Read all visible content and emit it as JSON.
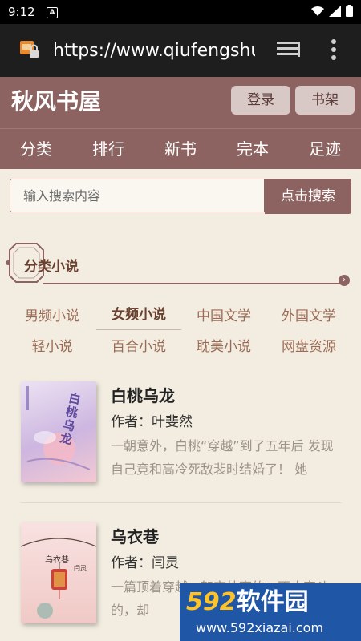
{
  "status_bar": {
    "time": "9:12",
    "notification_letter": "A"
  },
  "browser": {
    "url": "https://www.qiufengshuwu"
  },
  "header": {
    "title": "秋风书屋",
    "login_label": "登录",
    "shelf_label": "书架"
  },
  "nav": {
    "items": [
      "分类",
      "排行",
      "新书",
      "完本",
      "足迹"
    ]
  },
  "search": {
    "placeholder": "输入搜索内容",
    "button_label": "点击搜索"
  },
  "section": {
    "title": "分类小说"
  },
  "categories": [
    "男频小说",
    "女频小说",
    "中国文学",
    "外国文学",
    "轻小说",
    "百合小说",
    "耽美小说",
    "网盘资源"
  ],
  "active_category": "女频小说",
  "books": [
    {
      "title": "白桃乌龙",
      "author_label": "作者：",
      "author": "叶斐然",
      "description": "一朝意外，白桃“穿越”到了五年后 发现自己竟和高冷死敌裴时结婚了！ 她",
      "cover_text": "白桃乌龙",
      "cover_colors": [
        "#e8dcef",
        "#c9b0dd",
        "#f2c7cf"
      ]
    },
    {
      "title": "乌衣巷",
      "author_label": "作者：",
      "author": "闫灵",
      "description": "一篇顶着穿越、架空外壳的，不止宅斗的，却",
      "cover_text": "乌衣巷",
      "cover_author": "闫灵",
      "cover_colors": [
        "#f6dada",
        "#e9b9b4",
        "#c24a3d"
      ]
    }
  ],
  "watermark": {
    "brand_num": "592",
    "brand_text": "软件园",
    "site": "www.592xiazai.com"
  }
}
